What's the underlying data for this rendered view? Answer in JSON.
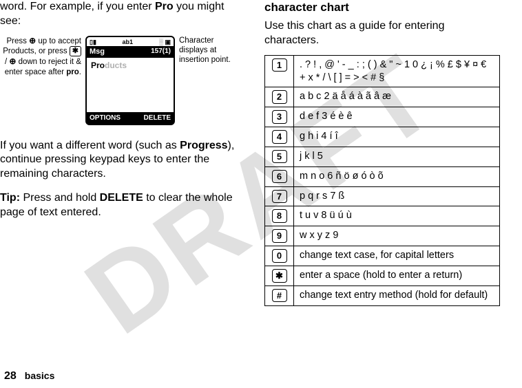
{
  "watermark": "DRAFT",
  "left": {
    "intro1": "word. For example, if you enter ",
    "introPro": "Pro",
    "intro2": " you might see:",
    "callout_left_l1": "Press ",
    "callout_left_nav1": "⊕",
    "callout_left_l2": " up to accept Products, or press ",
    "callout_left_key": "✱",
    "callout_left_l3": " / ",
    "callout_left_nav2": "⊕",
    "callout_left_l4": " down to reject it & enter space after ",
    "callout_left_pro": "pro",
    "callout_left_period": ".",
    "callout_right": "Character displays at insertion point.",
    "status_signal": "▯▮",
    "status_mode": "ab1",
    "status_bat": "░ ▣",
    "title_msg": "Msg",
    "title_count": "157(1)",
    "typed_pro": "Pro",
    "typed_rest": "ducts",
    "softkey_left": "OPTIONS",
    "softkey_right": "DELETE",
    "para2_a": "If you want a different word (such as ",
    "para2_progress": "Progress",
    "para2_b": "), continue pressing keypad keys to enter the remaining characters.",
    "tip_label": "Tip:",
    "tip_a": " Press and hold ",
    "tip_delete": "DELETE",
    "tip_b": " to clear the whole page of text entered."
  },
  "right": {
    "heading": "character chart",
    "intro": "Use this chart as a guide for entering characters."
  },
  "chart": [
    {
      "key": "1",
      "chars": ". ? ! , @ ' - _ : ; ( ) & \" ~ 1 0 ¿ ¡ % £ $ ¥ ¤ € + x * / \\ [ ] = > < # §"
    },
    {
      "key": "2",
      "chars": "a b c 2 ä å á à ã â æ"
    },
    {
      "key": "3",
      "chars": "d e f 3 é è ê"
    },
    {
      "key": "4",
      "chars": "g h i 4 í î"
    },
    {
      "key": "5",
      "chars": "j k l 5"
    },
    {
      "key": "6",
      "chars": "m n o 6 ñ ö ø ó ò õ"
    },
    {
      "key": "7",
      "chars": "p q r s 7 ß"
    },
    {
      "key": "8",
      "chars": "t u v 8 ü ú ù"
    },
    {
      "key": "9",
      "chars": "w x y z 9"
    },
    {
      "key": "0",
      "chars": "change text case, for capital letters"
    },
    {
      "key": "✱",
      "chars": "enter a space (hold to enter a return)"
    },
    {
      "key": "#",
      "chars": "change text entry method (hold for default)"
    }
  ],
  "footer": {
    "page": "28",
    "section": "basics"
  }
}
